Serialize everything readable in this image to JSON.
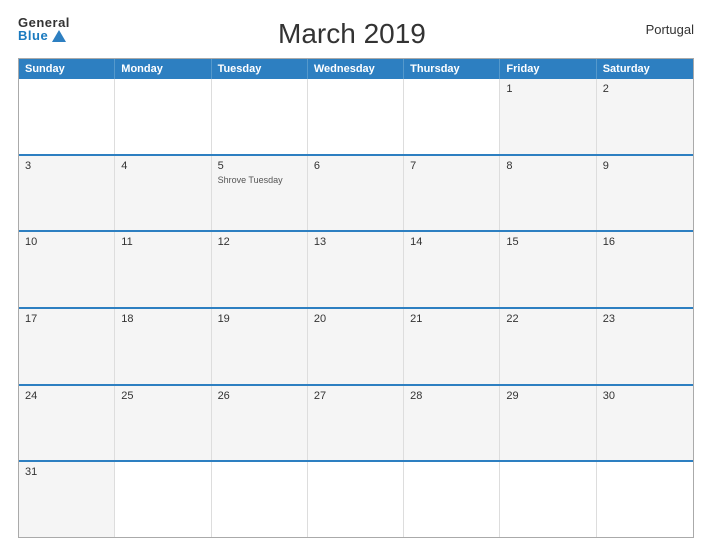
{
  "header": {
    "logo_general": "General",
    "logo_blue": "Blue",
    "title": "March 2019",
    "country": "Portugal"
  },
  "days_header": [
    "Sunday",
    "Monday",
    "Tuesday",
    "Wednesday",
    "Thursday",
    "Friday",
    "Saturday"
  ],
  "weeks": [
    [
      {
        "day": "",
        "holiday": ""
      },
      {
        "day": "",
        "holiday": ""
      },
      {
        "day": "",
        "holiday": ""
      },
      {
        "day": "",
        "holiday": ""
      },
      {
        "day": "",
        "holiday": ""
      },
      {
        "day": "1",
        "holiday": ""
      },
      {
        "day": "2",
        "holiday": ""
      }
    ],
    [
      {
        "day": "3",
        "holiday": ""
      },
      {
        "day": "4",
        "holiday": ""
      },
      {
        "day": "5",
        "holiday": "Shrove Tuesday"
      },
      {
        "day": "6",
        "holiday": ""
      },
      {
        "day": "7",
        "holiday": ""
      },
      {
        "day": "8",
        "holiday": ""
      },
      {
        "day": "9",
        "holiday": ""
      }
    ],
    [
      {
        "day": "10",
        "holiday": ""
      },
      {
        "day": "11",
        "holiday": ""
      },
      {
        "day": "12",
        "holiday": ""
      },
      {
        "day": "13",
        "holiday": ""
      },
      {
        "day": "14",
        "holiday": ""
      },
      {
        "day": "15",
        "holiday": ""
      },
      {
        "day": "16",
        "holiday": ""
      }
    ],
    [
      {
        "day": "17",
        "holiday": ""
      },
      {
        "day": "18",
        "holiday": ""
      },
      {
        "day": "19",
        "holiday": ""
      },
      {
        "day": "20",
        "holiday": ""
      },
      {
        "day": "21",
        "holiday": ""
      },
      {
        "day": "22",
        "holiday": ""
      },
      {
        "day": "23",
        "holiday": ""
      }
    ],
    [
      {
        "day": "24",
        "holiday": ""
      },
      {
        "day": "25",
        "holiday": ""
      },
      {
        "day": "26",
        "holiday": ""
      },
      {
        "day": "27",
        "holiday": ""
      },
      {
        "day": "28",
        "holiday": ""
      },
      {
        "day": "29",
        "holiday": ""
      },
      {
        "day": "30",
        "holiday": ""
      }
    ],
    [
      {
        "day": "31",
        "holiday": ""
      },
      {
        "day": "",
        "holiday": ""
      },
      {
        "day": "",
        "holiday": ""
      },
      {
        "day": "",
        "holiday": ""
      },
      {
        "day": "",
        "holiday": ""
      },
      {
        "day": "",
        "holiday": ""
      },
      {
        "day": "",
        "holiday": ""
      }
    ]
  ]
}
